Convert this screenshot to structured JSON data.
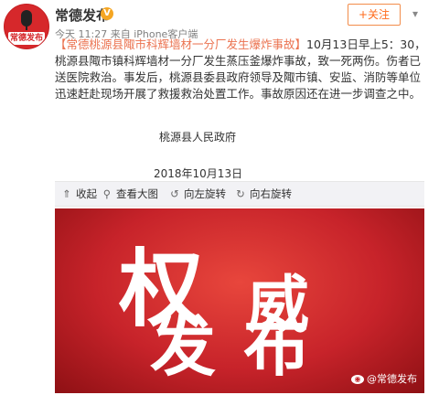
{
  "header": {
    "avatar_label": "常德发布",
    "username": "常德发布",
    "verified_icon": "verified-badge-icon",
    "time": "今天 11:27",
    "source": "来自 iPhone客户端",
    "follow_label": "+关注"
  },
  "post": {
    "title": "【常德桃源县陬市科辉墙材一分厂发生爆炸事故】",
    "body": "10月13日早上5：30，桃源县陬市镇科辉墙材一分厂发生蒸压釜爆炸事故，致一死两伤。伤者已送医院救治。事发后，桃源县委县政府领导及陬市镇、安监、消防等单位迅速赶赴现场开展了救援救治处置工作。事故原因还在进一步调查之中。",
    "signature": "桃源县人民政府",
    "date": "2018年10月13日"
  },
  "toolbar": {
    "collapse_label": "收起",
    "view_large_label": "查看大图",
    "rotate_left_label": "向左旋转",
    "rotate_right_label": "向右旋转"
  },
  "image": {
    "char1": "权",
    "char2": "威",
    "char3": "发",
    "char4": "布",
    "watermark": "@常德发布",
    "background_color": "#c7232a"
  }
}
